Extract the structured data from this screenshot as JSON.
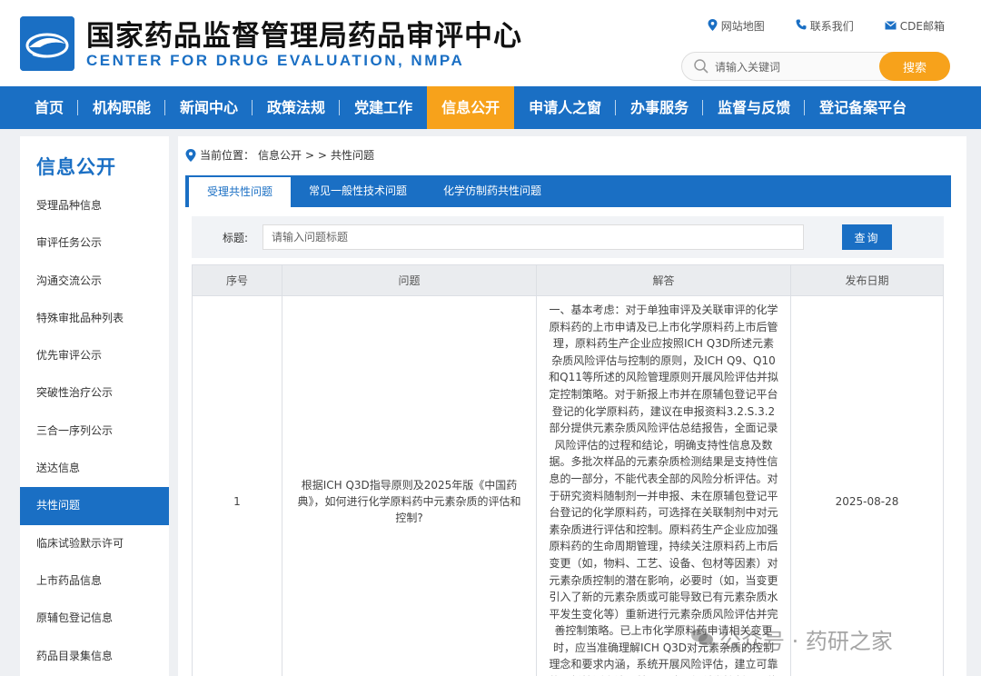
{
  "header": {
    "title_cn": "国家药品监督管理局药品审评中心",
    "title_en": "CENTER FOR DRUG EVALUATION, NMPA",
    "links": [
      {
        "label": "网站地图",
        "icon": "map-pin-icon"
      },
      {
        "label": "联系我们",
        "icon": "phone-icon"
      },
      {
        "label": "CDE邮箱",
        "icon": "mail-icon"
      }
    ],
    "search": {
      "placeholder": "请输入关键词",
      "button": "搜索"
    }
  },
  "nav": {
    "items": [
      "首页",
      "机构职能",
      "新闻中心",
      "政策法规",
      "党建工作",
      "信息公开",
      "申请人之窗",
      "办事服务",
      "监督与反馈",
      "登记备案平台"
    ],
    "active": "信息公开"
  },
  "sidebar": {
    "title": "信息公开",
    "items": [
      "受理品种信息",
      "审评任务公示",
      "沟通交流公示",
      "特殊审批品种列表",
      "优先审评公示",
      "突破性治疗公示",
      "三合一序列公示",
      "送达信息",
      "共性问题",
      "临床试验默示许可",
      "上市药品信息",
      "原辅包登记信息",
      "药品目录集信息"
    ],
    "active": "共性问题"
  },
  "breadcrumb": {
    "label": "当前位置：",
    "path": "信息公开",
    "sep": "> >",
    "current": "共性问题"
  },
  "tabs": [
    "受理共性问题",
    "常见一般性技术问题",
    "化学仿制药共性问题"
  ],
  "filter": {
    "label": "标题:",
    "placeholder": "请输入问题标题",
    "button": "查询"
  },
  "table": {
    "headers": [
      "序号",
      "问题",
      "解答",
      "发布日期"
    ],
    "rows": [
      {
        "no": "1",
        "question": "根据ICH Q3D指导原则及2025年版《中国药典》，如何进行化学原料药中元素杂质的评估和控制?",
        "answer": "一、基本考虑：对于单独审评及关联审评的化学原料药的上市申请及已上市化学原料药上市后管理，原料药生产企业应按照ICH Q3D所述元素杂质风险评估与控制的原则，及ICH Q9、Q10和Q11等所述的风险管理原则开展风险评估并拟定控制策略。对于新报上市并在原辅包登记平台登记的化学原料药，建议在申报资料3.2.S.3.2部分提供元素杂质风险评估总结报告，全面记录风险评估的过程和结论，明确支持性信息及数据。多批次样品的元素杂质检测结果是支持性信息的一部分，不能代表全部的风险分析评估。对于研究资料随制剂一并申报、未在原辅包登记平台登记的化学原料药，可选择在关联制剂中对元素杂质进行评估和控制。原料药生产企业应加强原料药的生命周期管理，持续关注原料药上市后变更（如，物料、工艺、设备、包材等因素）对元素杂质控制的潜在影响，必要时（如，当变更引入了新的元素杂质或可能导致已有元素杂质水平发生变化等）重新进行元素杂质风险评估并完善控制策略。已上市化学原料药申请相关变更时，应当准确理解ICH Q3D对元素杂质的控制理念和要求内涵，系统开展风险评估，建立可靠的分析检测方法，基于风险进行科学控制。不能仅以部分批次的元素杂质检测结",
        "date": "2025-08-28"
      }
    ]
  },
  "watermark": "公众号 · 药研之家",
  "colors": {
    "primary": "#1a6fc4",
    "accent": "#f7a21b"
  }
}
